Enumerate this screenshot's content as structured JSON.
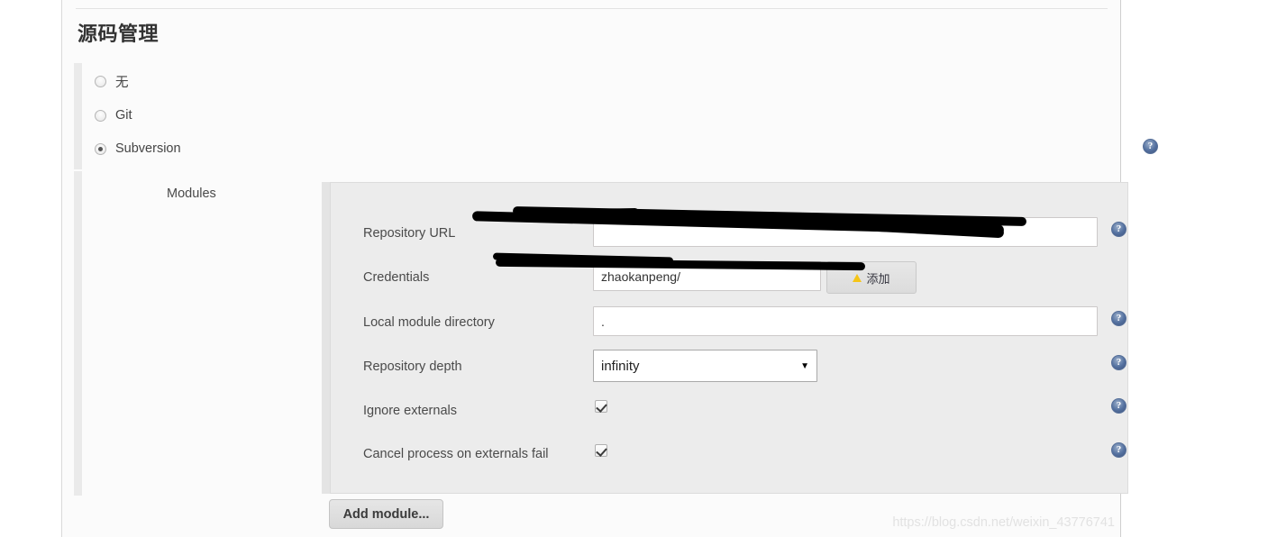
{
  "page": {
    "section_title": "源码管理",
    "watermark": "https://blog.csdn.net/weixin_43776741"
  },
  "scm_options": [
    {
      "label": "无",
      "selected": false
    },
    {
      "label": "Git",
      "selected": false
    },
    {
      "label": "Subversion",
      "selected": true
    }
  ],
  "modules": {
    "label": "Modules",
    "fields": {
      "repository_url": {
        "label": "Repository URL",
        "value": "",
        "redacted": true
      },
      "credentials": {
        "label": "Credentials",
        "value": "zhaokanpeng/",
        "redacted": true,
        "button_label": "添加"
      },
      "local_module_directory": {
        "label": "Local module directory",
        "value": "."
      },
      "repository_depth": {
        "label": "Repository depth",
        "value": "infinity",
        "caret": "▼"
      },
      "ignore_externals": {
        "label": "Ignore externals",
        "checked": true
      },
      "cancel_process_on_externals_fail": {
        "label": "Cancel process on externals fail",
        "checked": true
      }
    },
    "add_module_label": "Add module..."
  },
  "icons": {
    "help": "?"
  }
}
